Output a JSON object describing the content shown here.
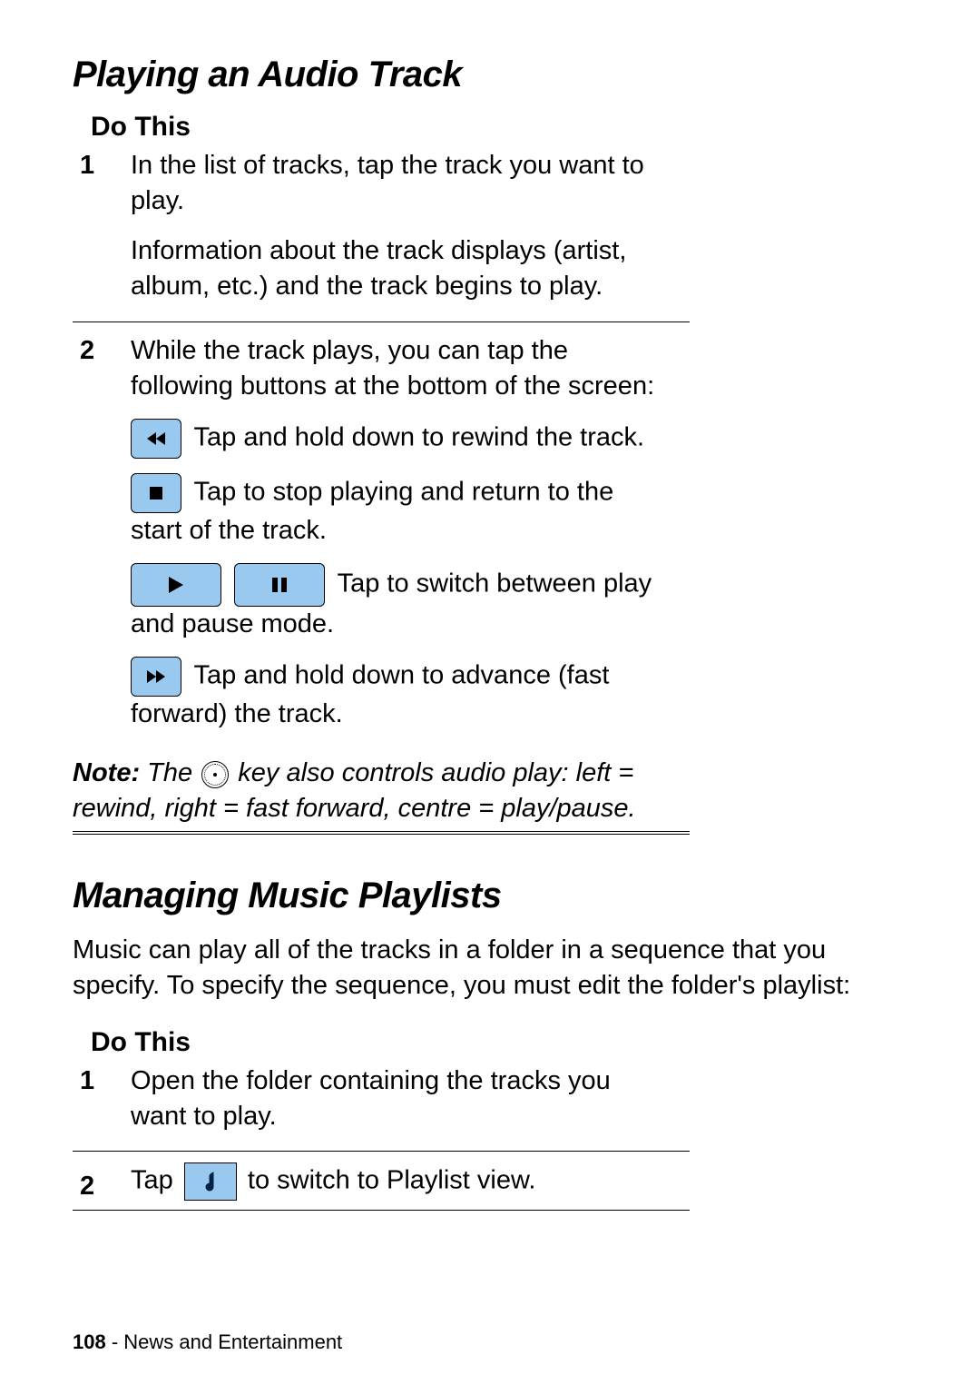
{
  "section1": {
    "title": "Playing an Audio Track",
    "do_this": "Do This",
    "steps": [
      {
        "num": "1",
        "p1": "In the list of tracks, tap the track you want to play.",
        "p2": "Information about the track displays (artist, album, etc.) and the track begins to play."
      },
      {
        "num": "2",
        "intro": "While the track plays, you can tap the following buttons at the bottom of the screen:",
        "b_rewind": " Tap and hold down to rewind the track.",
        "b_stop_a": " Tap to stop playing and return to the start of the track.",
        "b_play_a": " Tap to switch between play and pause mode.",
        "b_ff": " Tap and hold down to advance (fast forward) the track."
      }
    ],
    "note_prefix": "Note:",
    "note_a": " The ",
    "note_b": " key also controls audio play: left = rewind, right = fast forward, centre = play/pause."
  },
  "section2": {
    "title": "Managing Music Playlists",
    "intro": "Music can play all of the tracks in a folder in a sequence that you specify. To specify the sequence, you must edit the folder's playlist:",
    "do_this": "Do This",
    "steps": [
      {
        "num": "1",
        "p1": "Open the folder containing the tracks you want to play."
      },
      {
        "num": "2",
        "pre": "Tap ",
        "post": " to switch to Playlist view."
      }
    ]
  },
  "footer": {
    "page": "108",
    "label": " - News and Entertainment"
  }
}
